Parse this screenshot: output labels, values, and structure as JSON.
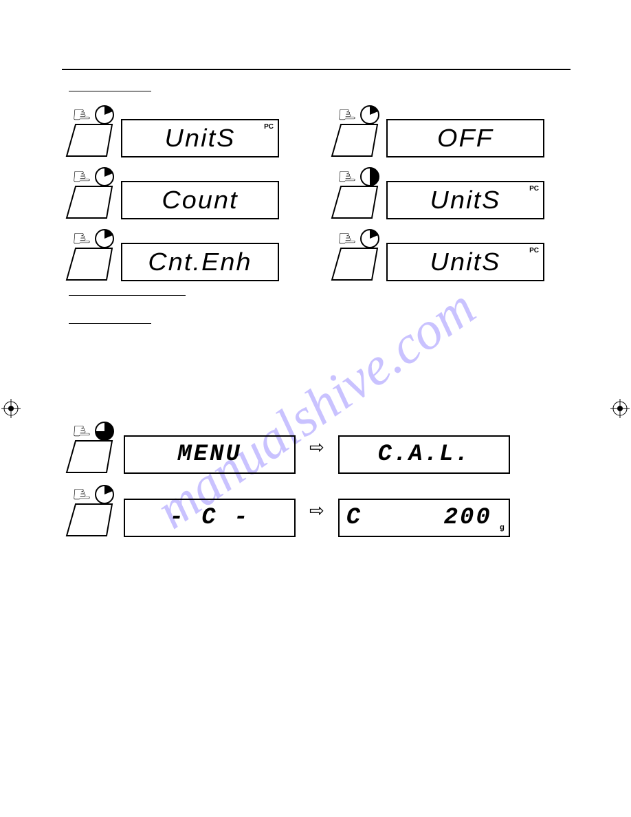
{
  "watermark": "manualshive.com",
  "section1": {
    "rows": [
      {
        "left": {
          "text": "UnitS",
          "pc": true
        },
        "right": {
          "text": "OFF",
          "pc": false
        }
      },
      {
        "left": {
          "text": "Count",
          "pc": false
        },
        "right": {
          "text": "UnitS",
          "pc": true
        }
      },
      {
        "left": {
          "text": "Cnt.Enh",
          "pc": false
        },
        "right": {
          "text": "UnitS",
          "pc": true
        }
      }
    ],
    "pie_left_fractions": [
      0.2,
      0.2,
      0.2
    ],
    "pie_right_fractions": [
      0.2,
      0.5,
      0.2
    ]
  },
  "section2": {
    "row1": {
      "pie": 0.75,
      "left": "MENU",
      "right": "C.A.L."
    },
    "row2": {
      "pie": 0.2,
      "left": "- C -",
      "right_prefix": "C",
      "right_value": "200",
      "right_unit": "g"
    }
  }
}
